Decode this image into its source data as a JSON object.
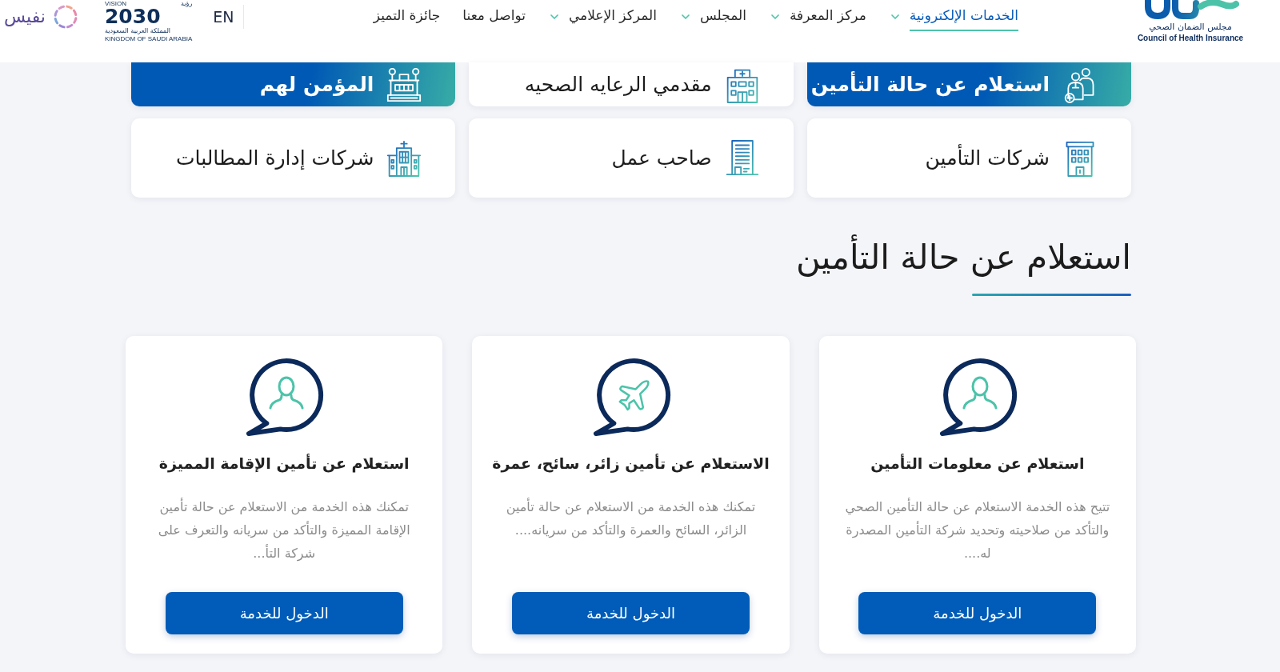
{
  "header": {
    "logo": {
      "name_ar": "مجلس الضمان الصحي",
      "name_en": "Council of Health Insurance"
    },
    "nav": [
      {
        "label": "الخدمات الإلكترونية",
        "selected": true,
        "has_menu": true
      },
      {
        "label": "مركز المعرفة",
        "selected": false,
        "has_menu": true
      },
      {
        "label": "المجلس",
        "selected": false,
        "has_menu": true
      },
      {
        "label": "المركز الإعلامي",
        "selected": false,
        "has_menu": true
      },
      {
        "label": "تواصل معنا",
        "selected": false,
        "has_menu": false
      },
      {
        "label": "جائزة التميز",
        "selected": false,
        "has_menu": false
      }
    ],
    "language": "EN",
    "vision_logo": {
      "label_en": "VISION",
      "label_ar": "رؤية",
      "year": "2030",
      "country_ar": "المملكة العربية السعودية",
      "country_en": "KINGDOM OF SAUDI ARABIA"
    },
    "partner_logo": {
      "name": "نفيس"
    }
  },
  "categories": [
    {
      "label": "استعلام عن حالة التأمين",
      "highlighted": true
    },
    {
      "label": "مقدمي الرعايه الصحيه",
      "highlighted": false
    },
    {
      "label": "المؤمن لهم",
      "highlighted": true
    },
    {
      "label": "شركات التأمين",
      "highlighted": false
    },
    {
      "label": "صاحب عمل",
      "highlighted": false
    },
    {
      "label": "شركات إدارة المطالبات",
      "highlighted": false
    }
  ],
  "section": {
    "title": "استعلام عن حالة التأمين"
  },
  "services": [
    {
      "title": "استعلام عن معلومات التأمين",
      "description": "تتيح هذه الخدمة الاستعلام عن حالة التأمين الصحي والتأكد من صلاحيته وتحديد شركة التأمين المصدرة له....",
      "button": "الدخول للخدمة"
    },
    {
      "title": "الاستعلام عن تأمين زائر، سائح، عمرة",
      "description": "تمكنك هذه الخدمة من الاستعلام عن حالة تأمين الزائر، السائح والعمرة والتأكد من سريانه....",
      "button": "الدخول للخدمة"
    },
    {
      "title": "استعلام عن تأمين الإقامة المميزة",
      "description": "تمكنك هذه الخدمة من الاستعلام عن حالة تأمين الإقامة المميزة والتأكد من سريانه والتعرف على شركة التأ...",
      "button": "الدخول للخدمة"
    }
  ]
}
